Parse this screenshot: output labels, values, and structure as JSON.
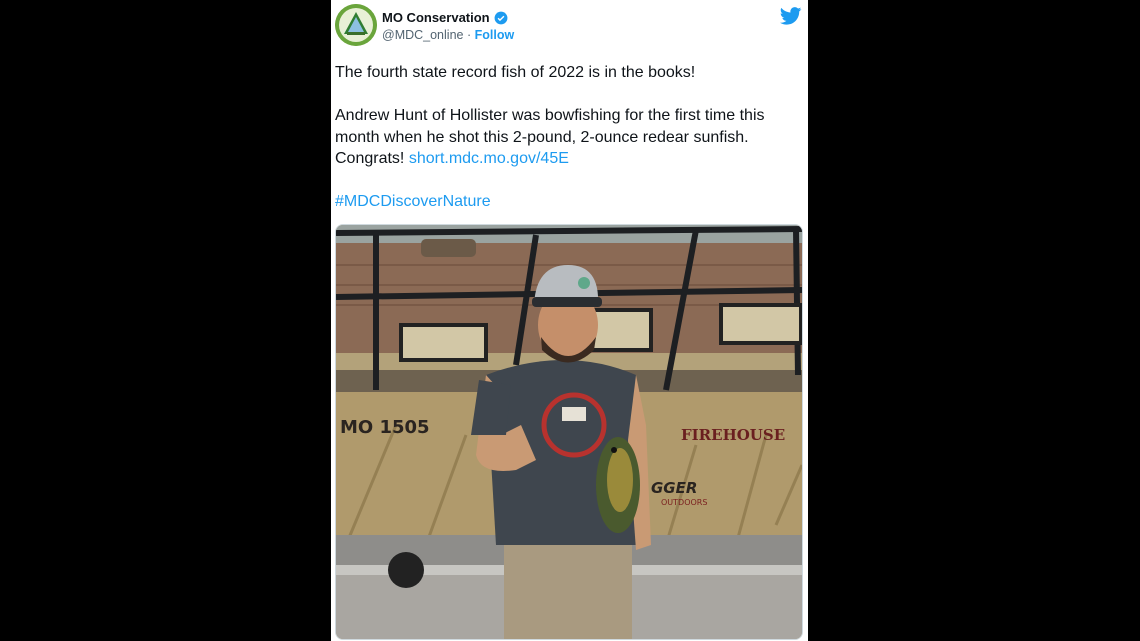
{
  "tweet": {
    "display_name": "MO Conservation",
    "handle": "@MDC_online",
    "separator": "·",
    "follow_label": "Follow",
    "paragraph1": "The fourth state record fish of 2022 is in the books!",
    "paragraph2_text": "Andrew Hunt of Hollister was bowfishing for the first time this month when he shot this 2-pound, 2-ounce redear sunfish. Congrats! ",
    "paragraph2_link": "short.mdc.mo.gov/45E",
    "hashtag": "#MDCDiscoverNature"
  },
  "photo": {
    "boat_registration": "MO 1505",
    "boat_brand": "FIREHOUSE",
    "boat_maker_partial": "GGER",
    "boat_maker_sub": "OUTDOORS"
  },
  "icons": {
    "avatar": "mdc-logo",
    "verified": "verified-badge-icon",
    "platform": "twitter-bird-icon"
  },
  "colors": {
    "link": "#1d9bf0",
    "background": "#000000",
    "card": "#ffffff"
  }
}
